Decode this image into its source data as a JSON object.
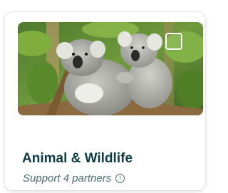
{
  "card": {
    "title": "Animal & Wildlife",
    "subtitle": "Support 4 partners",
    "info_icon": "info-icon",
    "image_alt": "koala-photo",
    "checkbox_checked": false
  },
  "colors": {
    "title": "#0e3b43",
    "subtitle": "#4a6d72"
  }
}
